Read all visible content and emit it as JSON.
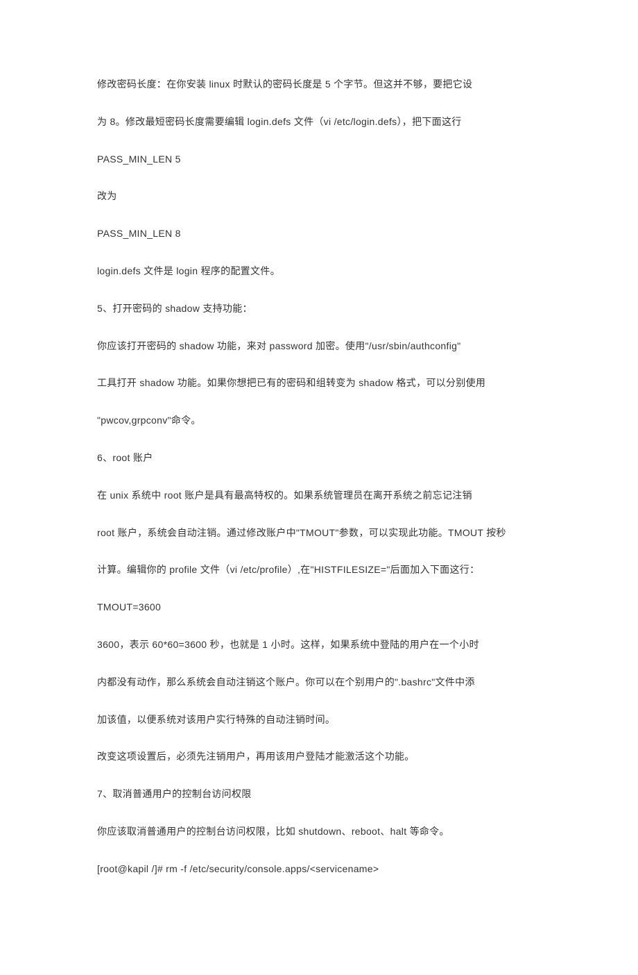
{
  "paragraphs": [
    "修改密码长度：在你安装 linux 时默认的密码长度是 5 个字节。但这并不够，要把它设",
    "为 8。修改最短密码长度需要编辑 login.defs 文件（vi /etc/login.defs），把下面这行",
    "PASS_MIN_LEN 5",
    "改为",
    "PASS_MIN_LEN 8",
    "login.defs 文件是 login 程序的配置文件。",
    "5、打开密码的 shadow 支持功能：",
    "你应该打开密码的 shadow 功能，来对 password 加密。使用\"/usr/sbin/authconfig\"",
    "工具打开 shadow 功能。如果你想把已有的密码和组转变为 shadow 格式，可以分别使用",
    "\"pwcov,grpconv\"命令。",
    "6、root 账户",
    "在 unix 系统中 root 账户是具有最高特权的。如果系统管理员在离开系统之前忘记注销",
    "root 账户，系统会自动注销。通过修改账户中\"TMOUT\"参数，可以实现此功能。TMOUT 按秒",
    "计算。编辑你的 profile 文件（vi /etc/profile）,在\"HISTFILESIZE=\"后面加入下面这行：",
    "TMOUT=3600",
    "3600，表示 60*60=3600 秒，也就是 1 小时。这样，如果系统中登陆的用户在一个小时",
    "内都没有动作，那么系统会自动注销这个账户。你可以在个别用户的\".bashrc\"文件中添",
    "加该值，以便系统对该用户实行特殊的自动注销时间。",
    "改变这项设置后，必须先注销用户，再用该用户登陆才能激活这个功能。",
    "7、取消普通用户的控制台访问权限",
    "你应该取消普通用户的控制台访问权限，比如 shutdown、reboot、halt 等命令。",
    "[root@kapil /]# rm -f /etc/security/console.apps/<servicename>"
  ]
}
